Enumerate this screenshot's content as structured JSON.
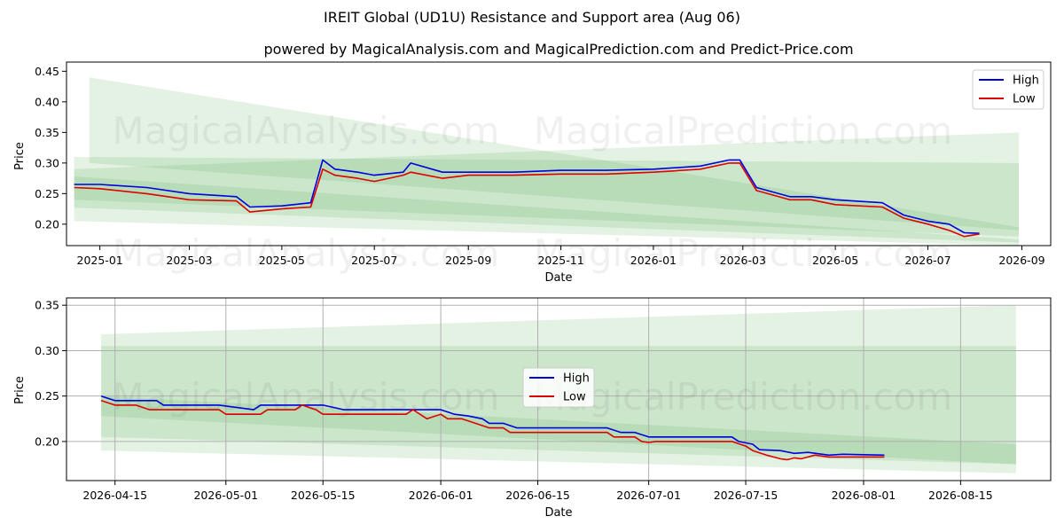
{
  "title": "IREIT Global (UD1U) Resistance and Support area (Aug 06)",
  "subtitle": "powered by MagicalAnalysis.com and MagicalPrediction.com and Predict-Price.com",
  "watermarks": [
    "MagicalAnalysis.com",
    "MagicalPrediction.com"
  ],
  "colors": {
    "high": "#0000dd",
    "low": "#dd0000",
    "band": "#2e9a2e",
    "grid": "#b0b0b0"
  },
  "chart_data": [
    {
      "type": "line",
      "xlabel": "Date",
      "ylabel": "Price",
      "xlim": [
        "2024-12-10",
        "2026-09-20"
      ],
      "ylim": [
        0.165,
        0.465
      ],
      "xticks": [
        "2025-01",
        "2025-03",
        "2025-05",
        "2025-07",
        "2025-09",
        "2025-11",
        "2026-01",
        "2026-03",
        "2026-05",
        "2026-07",
        "2026-09"
      ],
      "xtick_dates": [
        "2025-01-01",
        "2025-03-01",
        "2025-05-01",
        "2025-07-01",
        "2025-09-01",
        "2025-11-01",
        "2026-01-01",
        "2026-03-01",
        "2026-05-01",
        "2026-07-01",
        "2026-09-01"
      ],
      "yticks": [
        "0.20",
        "0.25",
        "0.30",
        "0.35",
        "0.40",
        "0.45"
      ],
      "legend": {
        "position": "top-right",
        "entries": [
          "High",
          "Low"
        ]
      },
      "grid": false,
      "series": [
        {
          "name": "High",
          "x": [
            "2024-12-15",
            "2025-01-01",
            "2025-02-01",
            "2025-03-01",
            "2025-04-01",
            "2025-04-10",
            "2025-05-01",
            "2025-05-20",
            "2025-05-28",
            "2025-06-05",
            "2025-06-20",
            "2025-07-01",
            "2025-07-20",
            "2025-07-25",
            "2025-08-15",
            "2025-09-01",
            "2025-10-01",
            "2025-11-01",
            "2025-12-01",
            "2026-01-01",
            "2026-02-01",
            "2026-02-20",
            "2026-02-27",
            "2026-03-10",
            "2026-04-01",
            "2026-04-15",
            "2026-05-01",
            "2026-06-01",
            "2026-06-15",
            "2026-07-01",
            "2026-07-15",
            "2026-07-25",
            "2026-08-04"
          ],
          "y": [
            0.265,
            0.265,
            0.26,
            0.25,
            0.245,
            0.228,
            0.23,
            0.235,
            0.305,
            0.29,
            0.285,
            0.28,
            0.285,
            0.3,
            0.285,
            0.285,
            0.285,
            0.288,
            0.288,
            0.29,
            0.295,
            0.305,
            0.305,
            0.26,
            0.245,
            0.245,
            0.24,
            0.235,
            0.215,
            0.205,
            0.2,
            0.186,
            0.185
          ]
        },
        {
          "name": "Low",
          "x": [
            "2024-12-15",
            "2025-01-01",
            "2025-02-01",
            "2025-03-01",
            "2025-04-01",
            "2025-04-10",
            "2025-05-01",
            "2025-05-20",
            "2025-05-28",
            "2025-06-05",
            "2025-06-20",
            "2025-07-01",
            "2025-07-20",
            "2025-07-25",
            "2025-08-15",
            "2025-09-01",
            "2025-10-01",
            "2025-11-01",
            "2025-12-01",
            "2026-01-01",
            "2026-02-01",
            "2026-02-20",
            "2026-02-27",
            "2026-03-10",
            "2026-04-01",
            "2026-04-15",
            "2026-05-01",
            "2026-06-01",
            "2026-06-15",
            "2026-07-01",
            "2026-07-15",
            "2026-07-25",
            "2026-08-04"
          ],
          "y": [
            0.26,
            0.258,
            0.25,
            0.24,
            0.238,
            0.22,
            0.225,
            0.228,
            0.29,
            0.28,
            0.275,
            0.27,
            0.28,
            0.285,
            0.275,
            0.28,
            0.28,
            0.282,
            0.282,
            0.285,
            0.29,
            0.3,
            0.3,
            0.255,
            0.24,
            0.24,
            0.232,
            0.228,
            0.21,
            0.2,
            0.19,
            0.18,
            0.184
          ]
        }
      ],
      "bands": [
        {
          "x0": "2024-12-15",
          "x1": "2026-08-30",
          "upper": [
            0.31,
            0.3
          ],
          "lower": [
            0.205,
            0.165
          ]
        },
        {
          "x0": "2024-12-15",
          "x1": "2026-08-30",
          "upper": [
            0.278,
            0.175
          ],
          "lower": [
            0.227,
            0.17
          ]
        },
        {
          "x0": "2024-12-25",
          "x1": "2026-08-30",
          "upper": [
            0.44,
            0.195
          ],
          "lower": [
            0.3,
            0.19
          ]
        },
        {
          "x0": "2024-12-15",
          "x1": "2026-08-30",
          "upper": [
            0.29,
            0.35
          ],
          "lower": [
            0.24,
            0.18
          ]
        }
      ]
    },
    {
      "type": "line",
      "xlabel": "Date",
      "ylabel": "Price",
      "xlim": [
        "2026-04-08",
        "2026-08-28"
      ],
      "ylim": [
        0.157,
        0.358
      ],
      "xticks": [
        "2026-04-15",
        "2026-05-01",
        "2026-05-15",
        "2026-06-01",
        "2026-06-15",
        "2026-07-01",
        "2026-07-15",
        "2026-08-01",
        "2026-08-15"
      ],
      "xtick_dates": [
        "2026-04-15",
        "2026-05-01",
        "2026-05-15",
        "2026-06-01",
        "2026-06-15",
        "2026-07-01",
        "2026-07-15",
        "2026-08-01",
        "2026-08-15"
      ],
      "yticks": [
        "0.20",
        "0.25",
        "0.30",
        "0.35"
      ],
      "legend": {
        "position": "center",
        "entries": [
          "High",
          "Low"
        ]
      },
      "grid": true,
      "series": [
        {
          "name": "High",
          "x": [
            "2026-04-13",
            "2026-04-15",
            "2026-04-21",
            "2026-04-22",
            "2026-04-30",
            "2026-05-05",
            "2026-05-06",
            "2026-05-12",
            "2026-05-15",
            "2026-05-18",
            "2026-06-01",
            "2026-06-03",
            "2026-06-05",
            "2026-06-07",
            "2026-06-08",
            "2026-06-10",
            "2026-06-12",
            "2026-06-25",
            "2026-06-27",
            "2026-06-29",
            "2026-07-01",
            "2026-07-13",
            "2026-07-14",
            "2026-07-16",
            "2026-07-17",
            "2026-07-20",
            "2026-07-22",
            "2026-07-24",
            "2026-07-27",
            "2026-07-29",
            "2026-08-04"
          ],
          "y": [
            0.25,
            0.245,
            0.245,
            0.24,
            0.24,
            0.235,
            0.24,
            0.24,
            0.24,
            0.235,
            0.235,
            0.23,
            0.228,
            0.225,
            0.22,
            0.22,
            0.215,
            0.215,
            0.21,
            0.21,
            0.205,
            0.205,
            0.2,
            0.197,
            0.191,
            0.19,
            0.187,
            0.188,
            0.185,
            0.186,
            0.185
          ]
        },
        {
          "name": "Low",
          "x": [
            "2026-04-13",
            "2026-04-15",
            "2026-04-18",
            "2026-04-20",
            "2026-04-30",
            "2026-05-01",
            "2026-05-06",
            "2026-05-07",
            "2026-05-11",
            "2026-05-12",
            "2026-05-14",
            "2026-05-15",
            "2026-05-27",
            "2026-05-28",
            "2026-05-30",
            "2026-06-01",
            "2026-06-02",
            "2026-06-04",
            "2026-06-06",
            "2026-06-08",
            "2026-06-10",
            "2026-06-11",
            "2026-06-25",
            "2026-06-26",
            "2026-06-29",
            "2026-06-30",
            "2026-07-01",
            "2026-07-02",
            "2026-07-13",
            "2026-07-15",
            "2026-07-16",
            "2026-07-18",
            "2026-07-20",
            "2026-07-21",
            "2026-07-22",
            "2026-07-23",
            "2026-07-25",
            "2026-07-27",
            "2026-08-04"
          ],
          "y": [
            0.245,
            0.24,
            0.24,
            0.235,
            0.235,
            0.23,
            0.23,
            0.235,
            0.235,
            0.24,
            0.235,
            0.23,
            0.23,
            0.235,
            0.225,
            0.23,
            0.225,
            0.225,
            0.22,
            0.215,
            0.215,
            0.21,
            0.21,
            0.205,
            0.205,
            0.2,
            0.199,
            0.2,
            0.2,
            0.195,
            0.19,
            0.185,
            0.181,
            0.18,
            0.182,
            0.181,
            0.185,
            0.183,
            0.183
          ]
        }
      ],
      "bands": [
        {
          "x0": "2026-04-13",
          "x1": "2026-08-23",
          "upper": [
            0.305,
            0.305
          ],
          "lower": [
            0.205,
            0.175
          ]
        },
        {
          "x0": "2026-04-13",
          "x1": "2026-08-23",
          "upper": [
            0.25,
            0.197
          ],
          "lower": [
            0.228,
            0.175
          ]
        },
        {
          "x0": "2026-04-13",
          "x1": "2026-08-23",
          "upper": [
            0.318,
            0.35
          ],
          "lower": [
            0.19,
            0.165
          ]
        }
      ]
    }
  ]
}
